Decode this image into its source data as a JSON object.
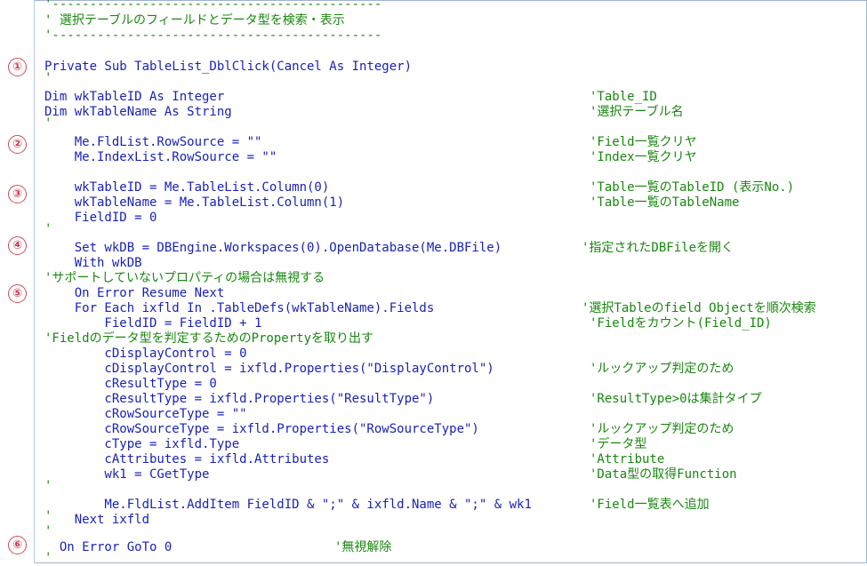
{
  "markers": [
    "①",
    "②",
    "③",
    "④",
    "⑤",
    "⑥"
  ],
  "header": {
    "dash_top": "'--------------------------------------------",
    "title": "' 選択テーブルのフィールドとデータ型を検索・表示",
    "dash_bottom": "'--------------------------------------------"
  },
  "lines": {
    "l1": "Private Sub TableList_DblClick(Cancel As Integer)",
    "l1b": "'",
    "l2": "Dim wkTableID As Integer",
    "l2c": "'Table_ID",
    "l3": "Dim wkTableName As String",
    "l3c": "'選択テーブル名",
    "l3b": "'",
    "l4": "    Me.FldList.RowSource = \"\"",
    "l4c": "'Field一覧クリヤ",
    "l5": "    Me.IndexList.RowSource = \"\"",
    "l5c": "'Index一覧クリヤ",
    "l6": "    wkTableID = Me.TableList.Column(0)",
    "l6c": "'Table一覧のTableID (表示No.)",
    "l7": "    wkTableName = Me.TableList.Column(1)",
    "l7c": "'Table一覧のTableName",
    "l8": "    FieldID = 0",
    "l8b": "'",
    "l9": "    Set wkDB = DBEngine.Workspaces(0).OpenDatabase(Me.DBFile)",
    "l9c": "'指定されたDBFileを開く",
    "l10": "    With wkDB",
    "l11": "'サポートしていないプロパティの場合は無視する",
    "l12": "    On Error Resume Next",
    "l13": "    For Each ixfld In .TableDefs(wkTableName).Fields",
    "l13c": "'選択Tableのfield Objectを順次検索",
    "l14": "        FieldID = FieldID + 1",
    "l14c": "'Fieldをカウント(Field_ID)",
    "l15": "'Fieldのデータ型を判定するためのPropertyを取り出す",
    "l16": "        cDisplayControl = 0",
    "l17": "        cDisplayControl = ixfld.Properties(\"DisplayControl\")",
    "l17c": "'ルックアップ判定のため",
    "l18": "        cResultType = 0",
    "l19": "        cResultType = ixfld.Properties(\"ResultType\")",
    "l19c": "'ResultType>0は集計タイプ",
    "l20": "        cRowSourceType = \"\"",
    "l21": "        cRowSourceType = ixfld.Properties(\"RowSourceType\")",
    "l21c": "'ルックアップ判定のため",
    "l22": "        cType = ixfld.Type",
    "l22c": "'データ型",
    "l23": "        cAttributes = ixfld.Attributes",
    "l23c": "'Attribute",
    "l24": "        wk1 = CGetType",
    "l24c": "'Data型の取得Function",
    "l24b": "'",
    "l25": "        Me.FldList.AddItem FieldID & \";\" & ixfld.Name & \";\" & wk1",
    "l25c": "'Field一覧表へ追加",
    "l25b": "'",
    "l26": "    Next ixfld",
    "l26b": "'",
    "l27": "  On Error GoTo 0",
    "l27c": "'無視解除",
    "l27b": "'"
  }
}
